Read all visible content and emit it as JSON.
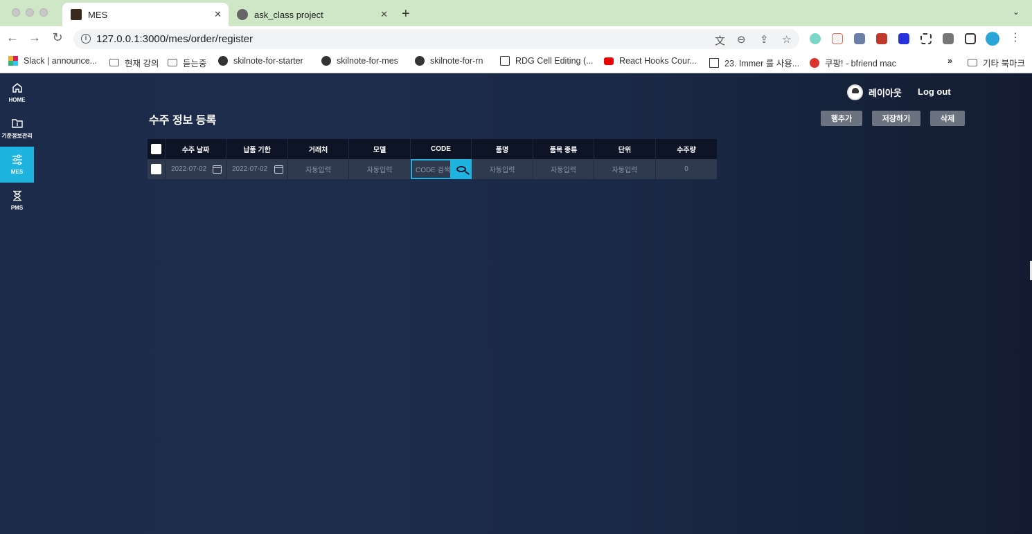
{
  "browser": {
    "tabs": [
      {
        "title": "MES",
        "active": true
      },
      {
        "title": "ask_class project",
        "active": false
      }
    ],
    "url": "127.0.0.1:3000/mes/order/register",
    "bookmarks": [
      "Slack | announce...",
      "현재 강의",
      "듣는중",
      "skilnote-for-starter",
      "skilnote-for-mes",
      "skilnote-for-rn",
      "RDG Cell Editing (...",
      "React Hooks Cour...",
      "23. Immer 를 사용...",
      "쿠팡! - bfriend mac",
      "기타 북마크"
    ],
    "bookmark_overflow": "»"
  },
  "sidebar": {
    "items": [
      {
        "label": "HOME",
        "icon": "home-icon"
      },
      {
        "label": "기준정보관리",
        "icon": "folder-icon"
      },
      {
        "label": "MES",
        "icon": "sliders-icon",
        "active": true
      },
      {
        "label": "PMS",
        "icon": "hourglass-icon"
      }
    ]
  },
  "header": {
    "username": "레이아웃",
    "logout": "Log out"
  },
  "page": {
    "title": "수주 정보 등록"
  },
  "actions": {
    "add_row": "행추가",
    "save": "저장하기",
    "delete": "삭제"
  },
  "grid": {
    "columns": [
      "수주 날짜",
      "납품 기한",
      "거래처",
      "모델",
      "CODE",
      "품명",
      "품목 종류",
      "단위",
      "수주량"
    ],
    "row": {
      "order_date": "2022-07-02",
      "due_date": "2022-07-02",
      "customer": "자동입력",
      "model": "자동입력",
      "code_placeholder": "CODE 검색",
      "item_name": "자동입력",
      "item_type": "자동입력",
      "unit": "자동입력",
      "quantity": "0"
    }
  },
  "colors": {
    "accent": "#1fb3e0",
    "background": "#1b2742",
    "grid_header": "#0c1426",
    "grid_row": "#2f3a4f",
    "button": "#6b7280"
  }
}
